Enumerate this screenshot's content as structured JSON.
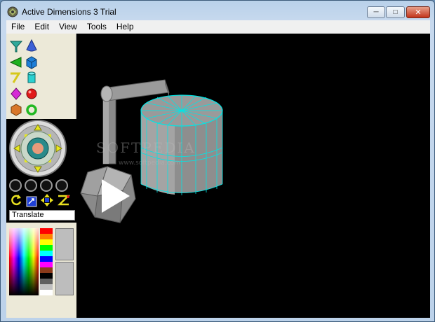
{
  "window": {
    "title": "Active Dimensions 3 Trial",
    "minimize_glyph": "─",
    "maximize_glyph": "□",
    "close_glyph": "✕"
  },
  "menu": {
    "items": [
      {
        "id": "file",
        "label": "File"
      },
      {
        "id": "edit",
        "label": "Edit"
      },
      {
        "id": "view",
        "label": "View"
      },
      {
        "id": "tools",
        "label": "Tools"
      },
      {
        "id": "help",
        "label": "Help"
      }
    ]
  },
  "tools": {
    "primitives": [
      "funnel-icon",
      "cone-icon",
      "wedge-icon",
      "cube-icon",
      "bent-tube-icon",
      "cylinder-icon",
      "octahedron-icon",
      "sphere-icon",
      "dodecahedron-icon",
      "torus-icon"
    ]
  },
  "navigator": {
    "mode_label": "Translate",
    "icons": [
      "rotate-icon",
      "zoom-icon",
      "move-arrows-icon",
      "axis-icon"
    ]
  },
  "colors": {
    "palette": [
      "#ff0000",
      "#ffff00",
      "#00ff00",
      "#00ffff",
      "#0000ff",
      "#ff00ff",
      "#ffffff",
      "#bdbdbd",
      "#808080",
      "#000000",
      "#c0c0c0",
      "#404040"
    ]
  },
  "viewport": {
    "background": "#000000",
    "selection_color": "#00e5e5",
    "object_color": "#9a9a9a"
  },
  "watermark": {
    "main": "SOFTPEDIA",
    "sub": "www.softpedia.com"
  }
}
